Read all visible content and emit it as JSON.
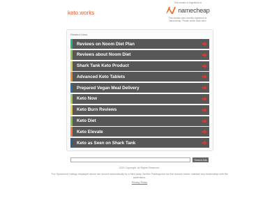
{
  "header": {
    "domain": "keto.works"
  },
  "registrar": {
    "note": "This domain is registered at",
    "name": "namecheap",
    "sub": "This domain was recently registered at Namecheap. Please check back later!",
    "brand_color": "#f26e22"
  },
  "related": {
    "title": "Related Links",
    "items": [
      {
        "label": "Reviews on Noom Diet Plan",
        "accent": "#2bb673"
      },
      {
        "label": "Reviews about Noom Diet",
        "accent": "#8bc34a"
      },
      {
        "label": "Shark Tank Keto Product",
        "accent": "#c8d64a"
      },
      {
        "label": "Advanced Keto Tablets",
        "accent": "#f28c2b"
      },
      {
        "label": "Prepared Vegan Meal Delivery",
        "accent": "#2e6da4"
      },
      {
        "label": "Keto Now",
        "accent": "#a5cf4c"
      },
      {
        "label": "Keto Burn Reviews",
        "accent": "#f2d22b"
      },
      {
        "label": "Keto Diet",
        "accent": "#8fc14f"
      },
      {
        "label": "Keto Elevate",
        "accent": "#ef7d3c"
      },
      {
        "label": "Keto as Seen on Shark Tank",
        "accent": "#2f5f8a"
      }
    ],
    "arrow_color": "#e8352c",
    "row_bg": "#575757"
  },
  "search": {
    "value": "",
    "button_label": "Search Ads"
  },
  "footer": {
    "copyright": "2020 Copyright. All Rights Reserved.",
    "disclaimer": "The Sponsored Listings displayed above are served automatically by a third party. Neither Parkingcrew nor the domain owner maintain any relationship with the advertisers.",
    "privacy": "Privacy Policy"
  }
}
